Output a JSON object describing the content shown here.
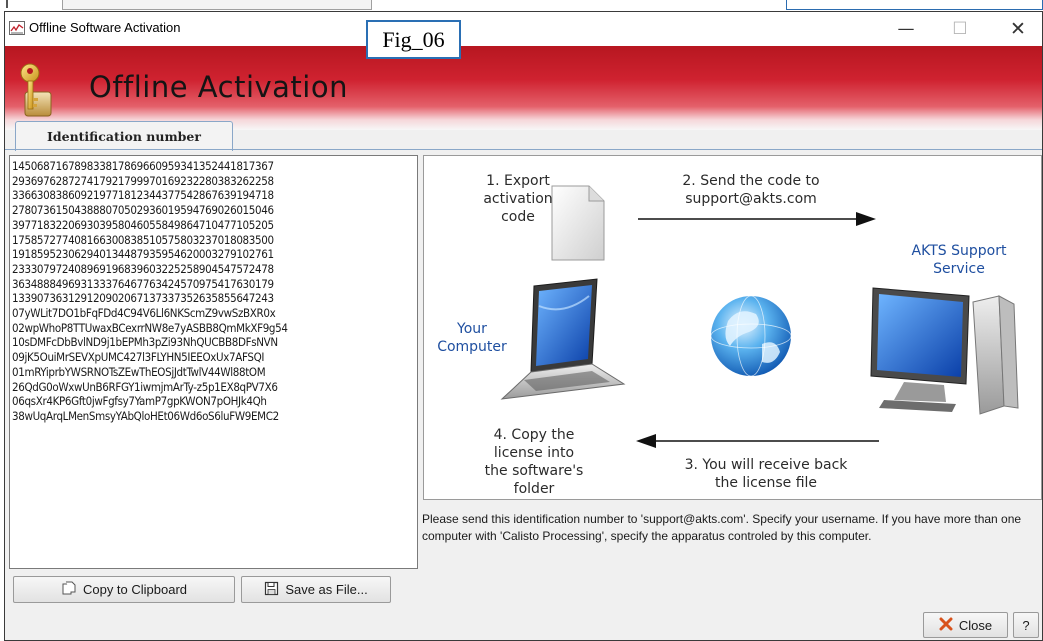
{
  "window": {
    "title": "Offline Software Activation",
    "controls": {
      "minimize": "—",
      "maximize": "☐",
      "close": "✕"
    }
  },
  "figure_label": "Fig_06",
  "banner": {
    "heading": "Offline Activation",
    "icon": "key-lock-icon"
  },
  "tab": {
    "label": "Identification number"
  },
  "identification_code": [
    "1450687167898338178696609593413524418173​67",
    "2936976287274179217999701692322803832622​58",
    "3366308386092197718123443775428676391947​18",
    "2780736150438880705029360195947690260150​46",
    "3977183220693039580460558498647104771052​05",
    "1758572774081663008385105758032370180835​00",
    "1918595230629401344879359546200032791027​61",
    "2333079724089691968396032252589045475724​78",
    "3634888496931333764677634245709754176301​79",
    "1339073631291209020671373373526358556472​43",
    "07yWLit7DO1bFqFDd4C94V6Ll6NKScmZ9vwSzBXR0x",
    "02wpWhoP8TTUwaxBCexrrNW8e7yASBB8QmMkXF9g54",
    "10sDMFcDbBvlND9j1bEPMh3pZi93NhQUCBB8DFsNVN",
    "09jK5OuiMrSEVXpUMC427l3FLYHN5IEEOxUx7AFSQI",
    "01mRYiprbYWSRNOTsZEwThEOSjJdtTwlV44Wl88tOM",
    "26QdG0oWxwUnB6RFGY1iwmjmArTy-z5p1EX8qPV7X6",
    "06qsXr4KP6Gft0jwFgfsy7YamP7gpKWON7pOHJk4Qh",
    "38wUqArqLMenSmsyYAbQloHEt06Wd6oS6luFW9EMC2"
  ],
  "diagram": {
    "step1": [
      "1. Export",
      "activation",
      "code"
    ],
    "step2": [
      "2. Send the code to",
      "support@akts.com"
    ],
    "support_label": [
      "AKTS Support",
      "Service"
    ],
    "computer_label": [
      "Your",
      "Computer"
    ],
    "step3": [
      "3. You will receive back",
      "the license file"
    ],
    "step4": [
      "4. Copy the",
      "license into",
      "the software's",
      "folder"
    ],
    "icons": [
      "document-icon",
      "laptop-icon",
      "globe-icon",
      "server-monitor-icon"
    ]
  },
  "instructions": "Please send this identification number to 'support@akts.com'. Specify your username. If you have more than one computer with 'Calisto Processing', specify the apparatus controled by this computer.",
  "buttons": {
    "copy": "Copy to Clipboard",
    "save": "Save as File...",
    "close": "Close",
    "help": "?"
  },
  "colors": {
    "banner_red": "#cf2230",
    "tab_border": "#8aa7c8",
    "fig_label_border": "#2a6fb4",
    "label_blue": "#1f4fa0"
  }
}
